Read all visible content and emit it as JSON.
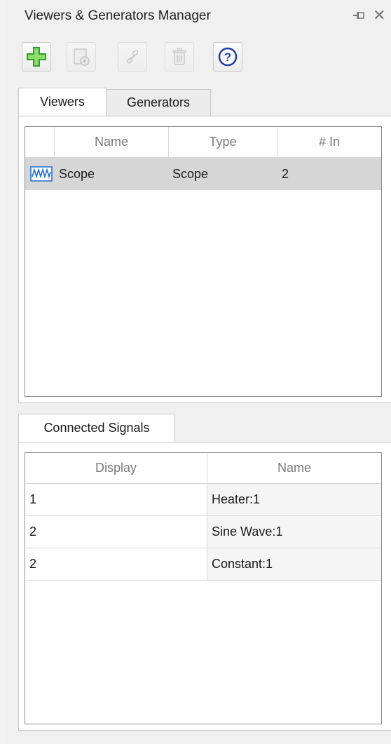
{
  "window": {
    "title": "Viewers & Generators Manager"
  },
  "toolbar": {
    "buttons": [
      {
        "name": "add-viewer-button",
        "icon": "plus-icon",
        "enabled": true
      },
      {
        "name": "open-parameters-button",
        "icon": "parameters-icon",
        "enabled": false
      },
      {
        "name": "link-button",
        "icon": "link-icon",
        "enabled": false
      },
      {
        "name": "delete-button",
        "icon": "trash-icon",
        "enabled": false
      },
      {
        "name": "help-button",
        "icon": "help-icon",
        "enabled": true
      }
    ]
  },
  "tabs": {
    "viewers_label": "Viewers",
    "generators_label": "Generators"
  },
  "viewers_table": {
    "headers": {
      "name": "Name",
      "type": "Type",
      "inputs": "# In"
    },
    "rows": [
      {
        "icon": "scope-icon",
        "name": "Scope",
        "type": "Scope",
        "inputs": "2",
        "selected": true
      }
    ]
  },
  "signals_tab": {
    "label": "Connected Signals"
  },
  "signals_table": {
    "headers": {
      "display": "Display",
      "name": "Name"
    },
    "rows": [
      {
        "display": "1",
        "name": "Heater:1"
      },
      {
        "display": "2",
        "name": "Sine Wave:1"
      },
      {
        "display": "2",
        "name": "Constant:1"
      }
    ]
  },
  "colors": {
    "selected_row": "#d6d6d6",
    "add_icon": "#2e9e2e",
    "help_icon": "#1f3f9e",
    "scope_icon": "#1f6fd0"
  }
}
